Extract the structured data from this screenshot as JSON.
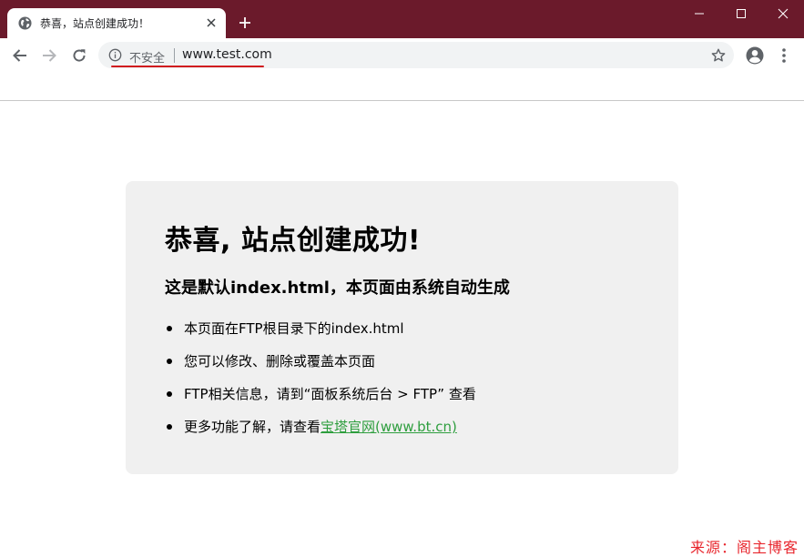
{
  "tab": {
    "title": "恭喜，站点创建成功！",
    "favicon": "globe-icon"
  },
  "window_controls": {
    "minimize_icon": "minimize-icon",
    "maximize_icon": "maximize-icon",
    "close_icon": "close-icon"
  },
  "omnibox": {
    "security_text": "不安全",
    "url": "www.test.com"
  },
  "page": {
    "heading": "恭喜, 站点创建成功!",
    "subheading": "这是默认index.html，本页面由系统自动生成",
    "items": [
      {
        "text": "本页面在FTP根目录下的index.html"
      },
      {
        "text": "您可以修改、删除或覆盖本页面"
      },
      {
        "text": "FTP相关信息，请到“面板系统后台 > FTP” 查看"
      },
      {
        "text": "更多功能了解，请查看",
        "link": "宝塔官网(www.bt.cn)"
      }
    ]
  },
  "watermark": "来源：阁主博客",
  "colors": {
    "titlebar": "#6b1a2b",
    "link": "#2e9e3e",
    "underline": "#d0191e",
    "watermark": "#e8262d"
  }
}
